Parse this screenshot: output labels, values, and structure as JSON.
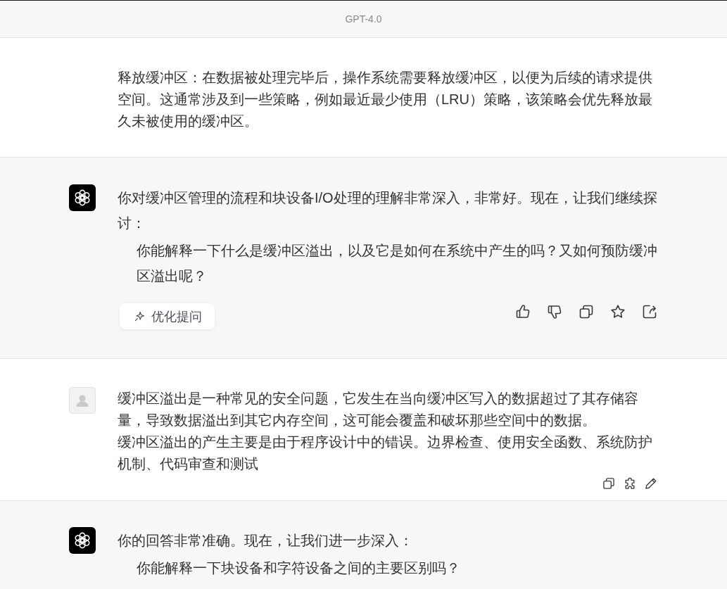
{
  "header": {
    "title": "GPT-4.0"
  },
  "messages": [
    {
      "kind": "user",
      "avatar": false,
      "paragraphs": [
        {
          "text": "释放缓冲区：在数据被处理完毕后，操作系统需要释放缓冲区，以便为后续的请求提供空间。这通常涉及到一些策略，例如最近最少使用（LRU）策略，该策略会优先释放最久未被使用的缓冲区。",
          "indented": false
        }
      ],
      "actions": false
    },
    {
      "kind": "assistant",
      "avatar": true,
      "paragraphs": [
        {
          "text": "你对缓冲区管理的流程和块设备I/O处理的理解非常深入，非常好。现在，让我们继续探讨：",
          "indented": false
        },
        {
          "text": "你能解释一下什么是缓冲区溢出，以及它是如何在系统中产生的吗？又如何预防缓冲区溢出呢？",
          "indented": true
        }
      ],
      "optimize_button": {
        "label": "优化提问"
      },
      "actions": true
    },
    {
      "kind": "user",
      "avatar": true,
      "paragraphs": [
        {
          "text": "缓冲区溢出是一种常见的安全问题，它发生在当向缓冲区写入的数据超过了其存储容量，导致数据溢出到其它内存空间，这可能会覆盖和破坏那些空间中的数据。",
          "indented": false
        },
        {
          "text": "缓冲区溢出的产生主要是由于程序设计中的错误。边界检查、使用安全函数、系统防护机制、代码审查和测试",
          "indented": false
        }
      ],
      "actions": true
    },
    {
      "kind": "assistant",
      "avatar": true,
      "paragraphs": [
        {
          "text": "你的回答非常准确。现在，让我们进一步深入：",
          "indented": false
        },
        {
          "text": "你能解释一下块设备和字符设备之间的主要区别吗？",
          "indented": true
        }
      ],
      "actions": false
    }
  ]
}
